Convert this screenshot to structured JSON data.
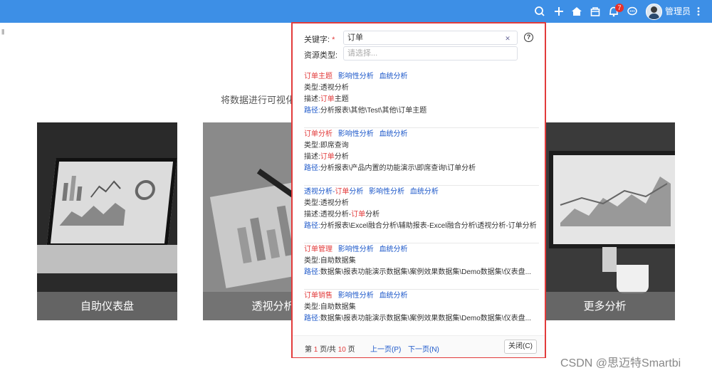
{
  "topbar": {
    "icons": [
      "search-icon",
      "plus-icon",
      "home-icon",
      "bag-icon",
      "bell-icon",
      "chat-icon",
      "more-icon"
    ],
    "notification_count": "7",
    "username": "管理员",
    "color": "#3d8fe6"
  },
  "page": {
    "subtitle": "将数据进行可视化的",
    "cards": [
      {
        "label": "自助仪表盘"
      },
      {
        "label": "透视分析"
      },
      {
        "label": "更多分析"
      }
    ]
  },
  "search_panel": {
    "keyword_label": "关键字:",
    "required_mark": "*",
    "keyword_value": "订单",
    "type_label": "资源类型:",
    "type_placeholder": "请选择...",
    "results": [
      {
        "title_pre": "",
        "title_hl": "订单主题",
        "title_post": "",
        "links": [
          "影响性分析",
          "血统分析"
        ],
        "type_label": "类型:",
        "type_value": "透视分析",
        "desc_label": "描述:",
        "desc_pre": "",
        "desc_hl": "订单",
        "desc_post": "主题",
        "path_label": "路径:",
        "path_value": "分析报表\\其他\\Test\\其他\\订单主题"
      },
      {
        "title_pre": "",
        "title_hl": "订单分析",
        "title_post": "",
        "links": [
          "影响性分析",
          "血统分析"
        ],
        "type_label": "类型:",
        "type_value": "即席查询",
        "desc_label": "描述:",
        "desc_pre": "",
        "desc_hl": "订单",
        "desc_post": "分析",
        "path_label": "路径:",
        "path_value": "分析报表\\产品内置的功能演示\\即席查询\\订单分析"
      },
      {
        "title_pre": "透视分析-",
        "title_hl": "订单",
        "title_post": "分析",
        "links": [
          "影响性分析",
          "血统分析"
        ],
        "type_label": "类型:",
        "type_value": "透视分析",
        "desc_label": "描述:",
        "desc_pre": "透视分析-",
        "desc_hl": "订单",
        "desc_post": "分析",
        "path_label": "路径:",
        "path_value": "分析报表\\Excel融合分析\\辅助报表-Excel融合分析\\透视分析-订单分析"
      },
      {
        "title_pre": "",
        "title_hl": "订单管理",
        "title_post": "",
        "links": [
          "影响性分析",
          "血统分析"
        ],
        "type_label": "类型:",
        "type_value": "自助数据集",
        "path_label": "路径:",
        "path_value": "数据集\\报表功能演示数据集\\案例效果数据集\\Demo数据集\\仪表盘..."
      },
      {
        "title_pre": "",
        "title_hl": "订单销售",
        "title_post": "",
        "links": [
          "影响性分析",
          "血统分析"
        ],
        "type_label": "类型:",
        "type_value": "自助数据集",
        "path_label": "路径:",
        "path_value": "数据集\\报表功能演示数据集\\案例效果数据集\\Demo数据集\\仪表盘..."
      }
    ],
    "pager": {
      "prefix": "第",
      "current": "1",
      "mid": "页/共",
      "total": "10",
      "suffix": "页",
      "prev": "上一页(P)",
      "next": "下一页(N)",
      "close": "关闭(C)"
    }
  },
  "watermark": "CSDN @思迈特Smartbi"
}
